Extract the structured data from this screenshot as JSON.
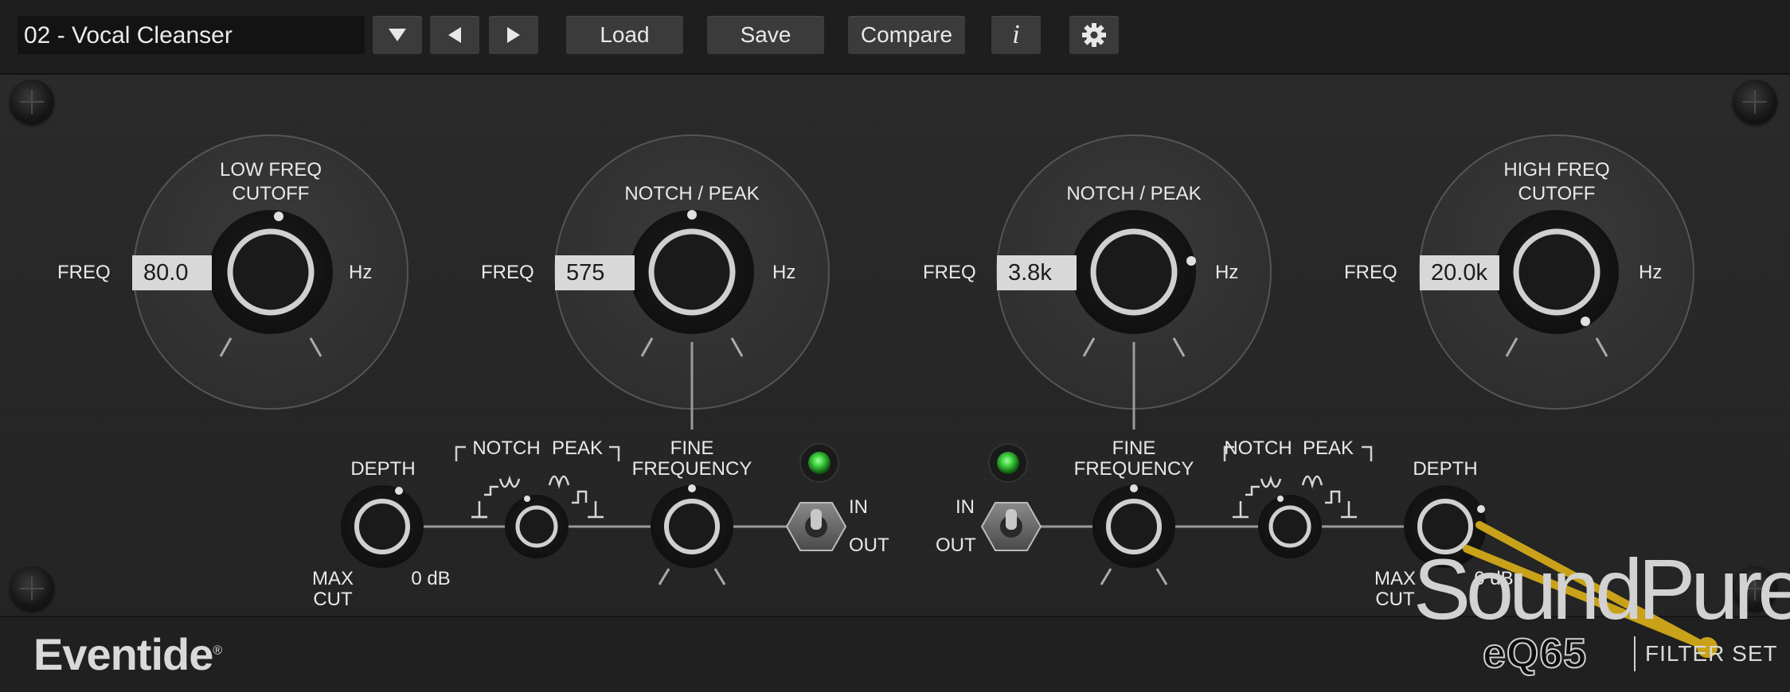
{
  "toolbar": {
    "preset_name": "02 - Vocal Cleanser",
    "buttons": {
      "dropdown_icon": "triangle-down-icon",
      "prev_icon": "triangle-left-icon",
      "next_icon": "triangle-right-icon",
      "load": "Load",
      "save": "Save",
      "compare": "Compare",
      "info": "i",
      "settings_icon": "gear-icon"
    }
  },
  "bands": {
    "low_cut": {
      "title_line1": "LOW FREQ",
      "title_line2": "CUTOFF",
      "freq_label": "FREQ",
      "value": "80.0",
      "unit": "Hz"
    },
    "notch1": {
      "title": "NOTCH / PEAK",
      "freq_label": "FREQ",
      "value": "575",
      "unit": "Hz"
    },
    "notch2": {
      "title": "NOTCH / PEAK",
      "freq_label": "FREQ",
      "value": "3.8k",
      "unit": "Hz"
    },
    "high_cut": {
      "title_line1": "HIGH FREQ",
      "title_line2": "CUTOFF",
      "freq_label": "FREQ",
      "value": "20.0k",
      "unit": "Hz"
    }
  },
  "controls": {
    "left": {
      "depth": "DEPTH",
      "max": "MAX",
      "cut": "CUT",
      "zero_db": "0 dB",
      "notch": "NOTCH",
      "peak": "PEAK",
      "fine1": "FINE",
      "fine2": "FREQUENCY",
      "in": "IN",
      "out": "OUT"
    },
    "right": {
      "depth": "DEPTH",
      "max": "MAX",
      "cut": "CUT",
      "zero_db": "0 dB",
      "notch": "NOTCH",
      "peak": "PEAK",
      "fine1": "FINE",
      "fine2": "FREQUENCY",
      "in": "IN",
      "out": "OUT"
    }
  },
  "branding": {
    "eventide": "Eventide",
    "registered": "®",
    "soundpure": "SoundPure",
    "eq65": "eQ65",
    "filter_set": "FILTER SET"
  },
  "colors": {
    "led_green": "#3fd03f",
    "soundpure_gold": "#c9a21a",
    "readout_bg": "#d8d8d8"
  }
}
